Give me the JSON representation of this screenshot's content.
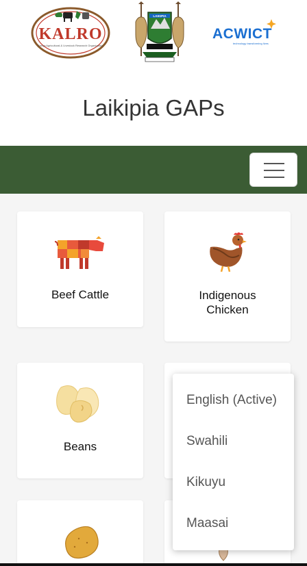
{
  "header": {
    "logos": [
      {
        "name": "KALRO",
        "text": "KALRO",
        "subtext": "Kenya Agricultural & Livestock Research Organization"
      },
      {
        "name": "Laikipia County",
        "text": "LAIKIPIA"
      },
      {
        "name": "ACWICT",
        "text": "ACWICT",
        "subtext": "technology transforming lives"
      }
    ],
    "title": "Laikipia GAPs"
  },
  "navbar": {
    "color": "#3b5c34",
    "toggler_icon": "hamburger-menu-icon"
  },
  "cards": [
    {
      "label": "Beef Cattle",
      "icon": "cow-icon"
    },
    {
      "label_lines": [
        "Indigenous",
        "Chicken"
      ],
      "icon": "chicken-icon"
    },
    {
      "label": "Beans",
      "icon": "beans-icon"
    },
    {
      "label": "",
      "icon": ""
    },
    {
      "label": "",
      "icon": "potato-icon"
    },
    {
      "label": "",
      "icon": ""
    }
  ],
  "language_menu": {
    "items": [
      "English (Active)",
      "Swahili",
      "Kikuyu",
      "Maasai"
    ]
  },
  "colors": {
    "page_bg": "#f5f5f5",
    "nav": "#3b5c34",
    "acwict_blue": "#1b6fd1",
    "kalro_red": "#c0392b"
  }
}
